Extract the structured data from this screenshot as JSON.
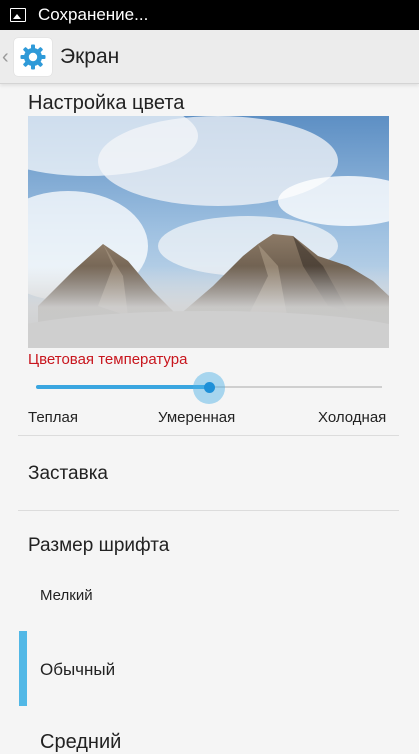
{
  "status_bar": {
    "icon": "image-icon",
    "text": "Сохранение..."
  },
  "action_bar": {
    "back_icon": "chevron-left-icon",
    "app_icon": "gear-icon",
    "title": "Экран"
  },
  "color_settings": {
    "title": "Настройка цвета",
    "temperature_label": "Цветовая температура",
    "slider_value": 0.5,
    "options": {
      "warm": "Теплая",
      "moderate": "Умеренная",
      "cold": "Холодная"
    },
    "accent_color": "#3aa6e0",
    "label_color": "#c8161e"
  },
  "screensaver": {
    "label": "Заставка"
  },
  "font_size": {
    "title": "Размер шрифта",
    "options": [
      "Мелкий",
      "Обычный",
      "Средний"
    ],
    "selected": "Обычный"
  }
}
